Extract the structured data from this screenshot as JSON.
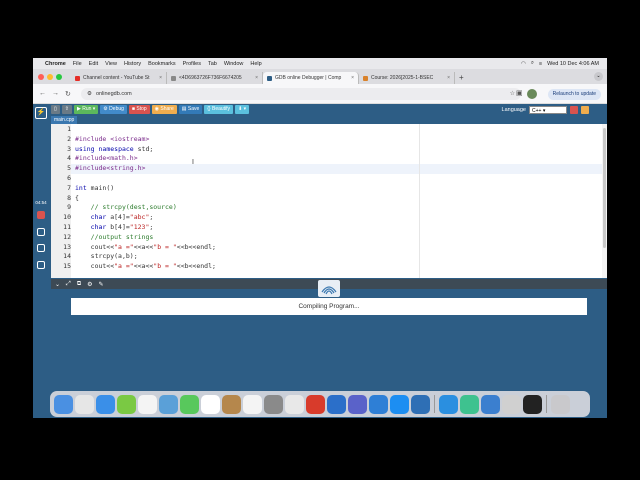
{
  "menubar": {
    "items": [
      "Chrome",
      "File",
      "Edit",
      "View",
      "History",
      "Bookmarks",
      "Profiles",
      "Tab",
      "Window",
      "Help"
    ],
    "datetime": "Wed 10 Dec  4:06 AM"
  },
  "tabs": [
    {
      "label": "Channel content - YouTube St",
      "favicon_color": "#e52d27",
      "active": false
    },
    {
      "label": "<4D6963726F736F6674205",
      "favicon_color": "#888888",
      "active": false
    },
    {
      "label": "GDB online Debugger | Comp",
      "favicon_color": "#2d5d85",
      "active": true
    },
    {
      "label": "Course: 2026[2025-1-BSEC",
      "favicon_color": "#d9822b",
      "active": false
    }
  ],
  "tab_close": "×",
  "new_tab": "+",
  "omnibox": {
    "url": "onlinegdb.com"
  },
  "relaunch_label": "Relaunch to update",
  "ide": {
    "buttons": {
      "run": "Run",
      "debug": "Debug",
      "stop": "Stop",
      "share": "Share",
      "save": "Save",
      "beautify": "{} Beautify",
      "download": "⬇"
    },
    "language_label": "Language",
    "language_value": "C++",
    "file_tab": "main.cpp",
    "timer": "04:54",
    "compiling_text": "Compiling Program...",
    "code_lines": [
      "",
      "#include <iostream>",
      "using namespace std;",
      "#include<math.h>",
      "#include<string.h>",
      "",
      "int main()",
      "{",
      "    // strcpy(dest,source)",
      "    char a[4]=\"abc\";",
      "    char b[4]=\"123\";",
      "    //output strings",
      "    cout<<\"a =\"<<a<<\"b = \"<<b<<endl;",
      "    strcpy(a,b);",
      "    cout<<\"a =\"<<a<<\"b = \"<<b<<endl;"
    ],
    "line_numbers": [
      "1",
      "2",
      "3",
      "4",
      "5",
      "6",
      "7",
      "8",
      "9",
      "10",
      "11",
      "12",
      "13",
      "14",
      "15"
    ]
  },
  "colors": {
    "onlinegdb_blue": "#2d5d85",
    "run_green": "#5cb85c",
    "debug_blue": "#428bca",
    "stop_red": "#d9534f",
    "share_orange": "#f0ad4e",
    "save_blue": "#337ab7",
    "beautify_teal": "#5bc0de"
  }
}
